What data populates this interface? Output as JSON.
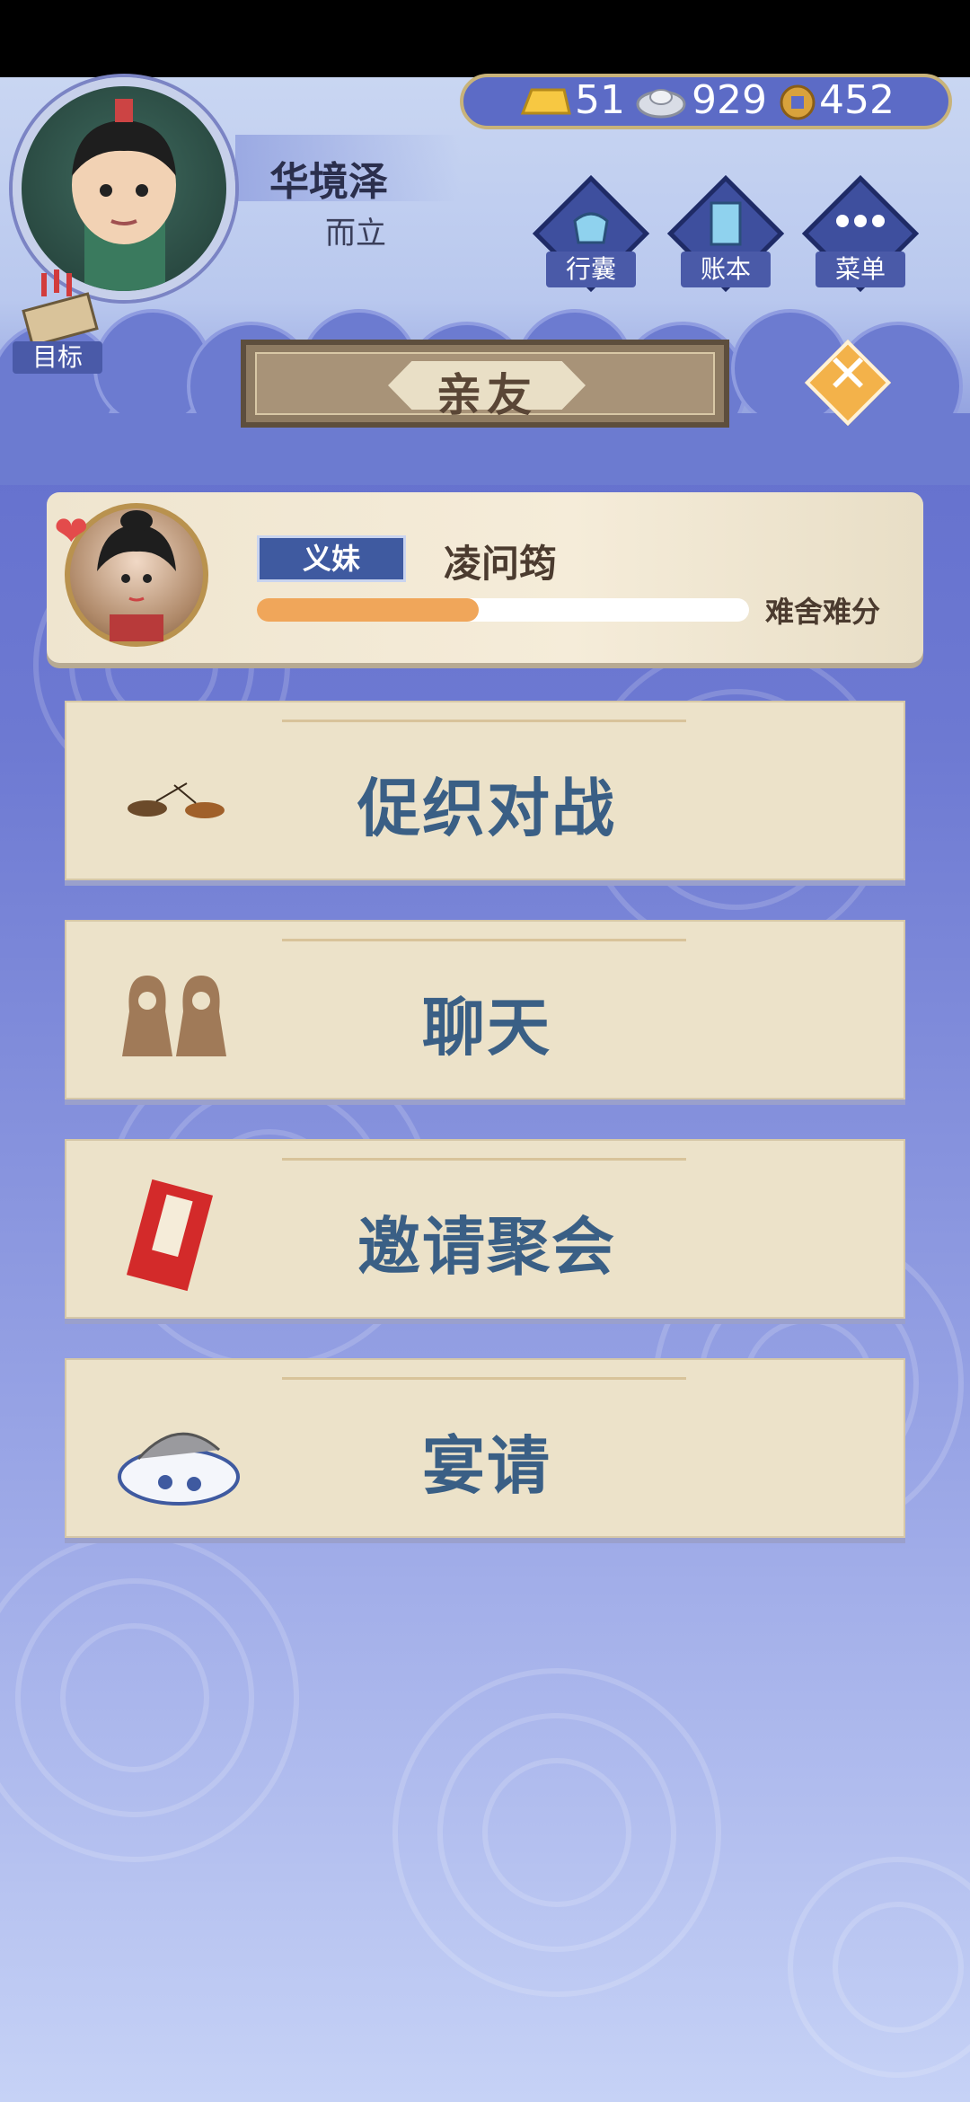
{
  "player": {
    "name": "华境泽",
    "age_title": "而立"
  },
  "currency": {
    "gold": "51",
    "silver": "929",
    "coins": "452"
  },
  "menu": {
    "bag": "行囊",
    "ledger": "账本",
    "menu": "菜单",
    "goal": "目标"
  },
  "page": {
    "title": "亲友"
  },
  "friend": {
    "relation": "义妹",
    "name": "凌问筠",
    "affection_label": "难舍难分",
    "affection_fraction": 0.45
  },
  "actions": [
    {
      "label": "促织对战",
      "icon": "cricket-icon"
    },
    {
      "label": "聊天",
      "icon": "chat-icon"
    },
    {
      "label": "邀请聚会",
      "icon": "invitation-icon"
    },
    {
      "label": "宴请",
      "icon": "banquet-icon"
    }
  ],
  "colors": {
    "accent_gold": "#f3b24a",
    "text_blue": "#3a5f85",
    "affection": "#f0a65a"
  }
}
